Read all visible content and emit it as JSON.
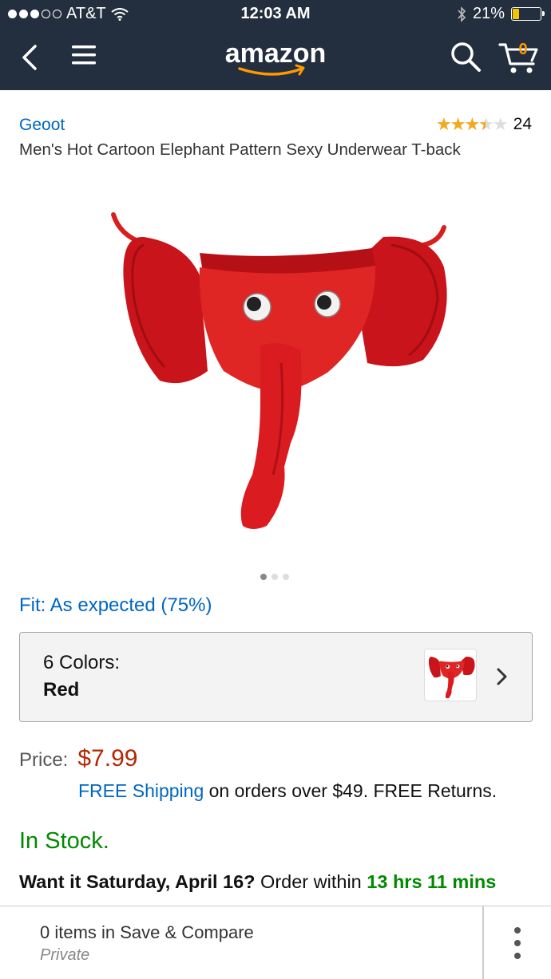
{
  "status_bar": {
    "carrier": "AT&T",
    "time": "12:03 AM",
    "battery": "21%",
    "battery_level": 0.21
  },
  "nav": {
    "logo_text": "amazon",
    "cart_count": "0"
  },
  "product": {
    "brand": "Geoot",
    "rating_value": 3.5,
    "rating_max": 5,
    "review_count": "24",
    "title": "Men's Hot Cartoon Elephant Pattern Sexy Underwear T-back",
    "image_pages": 3,
    "image_current_page": 1,
    "fit": "Fit: As expected (75%)"
  },
  "colors": {
    "label": "6 Colors:",
    "selected": "Red"
  },
  "price": {
    "label": "Price:",
    "value": "$7.99"
  },
  "shipping": {
    "link": "FREE Shipping",
    "text": " on orders over $49. FREE Returns."
  },
  "availability": "In Stock.",
  "delivery": {
    "prefix": "Want it Saturday, April 16?",
    "middle": " Order within ",
    "time_left": "13 hrs 11 mins"
  },
  "bottom_bar": {
    "save_compare": "0 items in Save & Compare",
    "privacy": "Private"
  },
  "colors_theme": {
    "nav_bg": "#232f3e",
    "link": "#0066c0",
    "price": "#b12704",
    "stock": "#008a00",
    "star": "#f4a81d",
    "logo_smile": "#ff9900"
  }
}
